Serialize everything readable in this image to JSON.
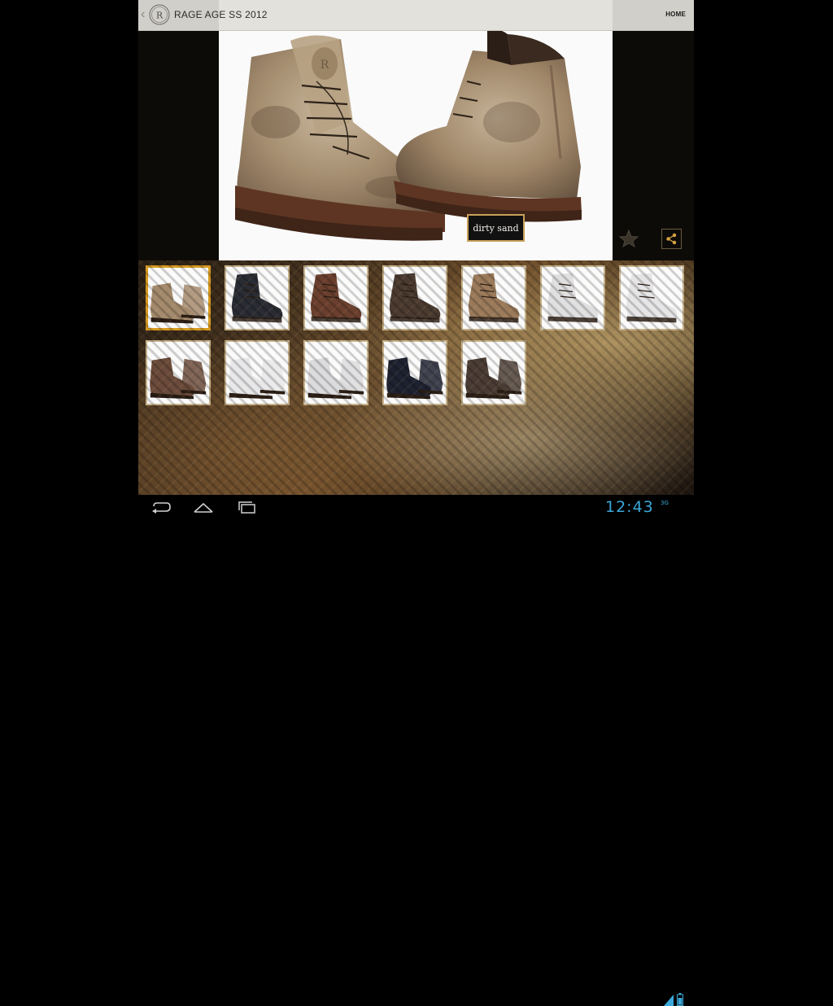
{
  "header": {
    "title": "RAGE AGE SS 2012",
    "home_label": "HOME",
    "logo_letter": "R"
  },
  "product": {
    "color_label": "dirty sand"
  },
  "gallery": {
    "thumbnails": [
      {
        "row": 1,
        "style": "tan-suede-boot-pair",
        "color": "#a48a6c",
        "selected": true
      },
      {
        "row": 1,
        "style": "black-leather-zip-sneaker",
        "color": "#2a2c33",
        "selected": false
      },
      {
        "row": 1,
        "style": "brown-zip-boot",
        "color": "#6a3f2e",
        "selected": false
      },
      {
        "row": 1,
        "style": "dark-brown-lace-boot",
        "color": "#4a3a30",
        "selected": false
      },
      {
        "row": 1,
        "style": "tan-suede-lace-boot",
        "color": "#9a7a5a",
        "selected": false
      },
      {
        "row": 1,
        "style": "white-high-top-sneaker",
        "color": "#e0e0e2",
        "selected": false
      },
      {
        "row": 1,
        "style": "white-zip-high-top",
        "color": "#e6e6e8",
        "selected": false
      },
      {
        "row": 2,
        "style": "brown-leather-boot-pair",
        "color": "#6a4a3a",
        "selected": false
      },
      {
        "row": 2,
        "style": "white-sneaker-pair",
        "color": "#e8e8ea",
        "selected": false
      },
      {
        "row": 2,
        "style": "white-high-top-pair",
        "color": "#dcdcde",
        "selected": false
      },
      {
        "row": 2,
        "style": "navy-sneaker-pair",
        "color": "#1e2230",
        "selected": false
      },
      {
        "row": 2,
        "style": "dark-brown-boot-pair",
        "color": "#4a3c34",
        "selected": false
      }
    ]
  },
  "system_bar": {
    "time": "12:43",
    "network": "3G",
    "accent": "#3aa8d8"
  },
  "colors": {
    "accent_gold": "#d79a1e",
    "label_border": "#c7a05a"
  }
}
